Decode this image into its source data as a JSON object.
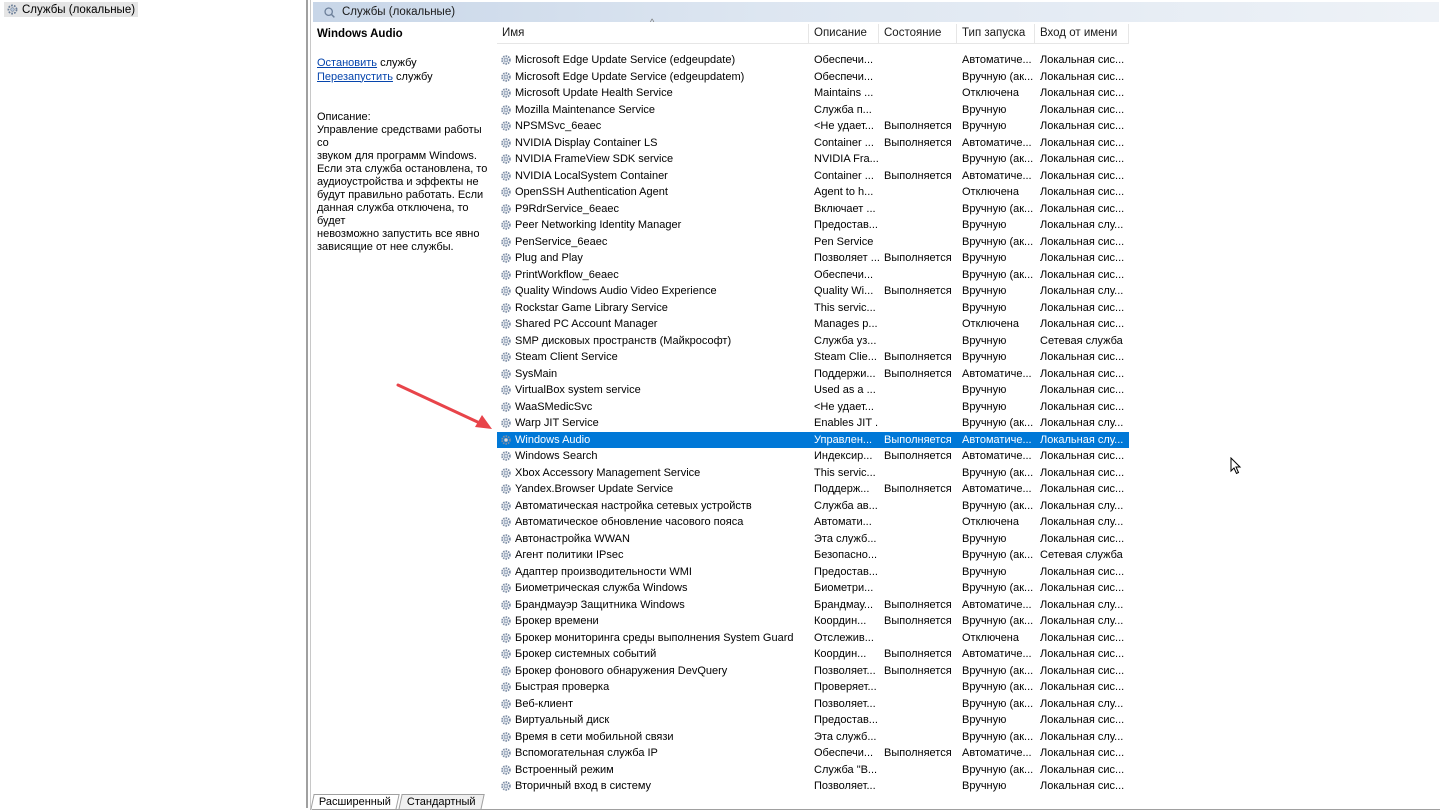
{
  "tree": {
    "root_label": "Службы (локальные)"
  },
  "header": {
    "title": "Службы (локальные)"
  },
  "details": {
    "service_title": "Windows Audio",
    "stop_link": "Остановить",
    "stop_suffix": " службу",
    "restart_link": "Перезапустить",
    "restart_suffix": " службу",
    "description_label": "Описание:",
    "description_lines": [
      "Управление средствами работы со",
      "звуком для программ Windows.",
      "Если эта служба остановлена, то",
      "аудиоустройства и эффекты не",
      "будут правильно работать.  Если",
      "данная служба отключена, то будет",
      "невозможно запустить все явно",
      "зависящие от нее службы."
    ]
  },
  "columns": {
    "name": "Имя",
    "description": "Описание",
    "state": "Состояние",
    "startup": "Тип запуска",
    "logon": "Вход от имени"
  },
  "selected_index": 23,
  "services": [
    [
      "Microsoft Edge Update Service (edgeupdate)",
      "Обеспечи...",
      "",
      "Автоматиче...",
      "Локальная сис..."
    ],
    [
      "Microsoft Edge Update Service (edgeupdatem)",
      "Обеспечи...",
      "",
      "Вручную (ак...",
      "Локальная сис..."
    ],
    [
      "Microsoft Update Health Service",
      "Maintains ...",
      "",
      "Отключена",
      "Локальная сис..."
    ],
    [
      "Mozilla Maintenance Service",
      "Служба п...",
      "",
      "Вручную",
      "Локальная сис..."
    ],
    [
      "NPSMSvc_6eaec",
      "<Не удает...",
      "Выполняется",
      "Вручную",
      "Локальная сис..."
    ],
    [
      "NVIDIA Display Container LS",
      "Container ...",
      "Выполняется",
      "Автоматиче...",
      "Локальная сис..."
    ],
    [
      "NVIDIA FrameView SDK service",
      "NVIDIA Fra...",
      "",
      "Вручную (ак...",
      "Локальная сис..."
    ],
    [
      "NVIDIA LocalSystem Container",
      "Container ...",
      "Выполняется",
      "Автоматиче...",
      "Локальная сис..."
    ],
    [
      "OpenSSH Authentication Agent",
      "Agent to h...",
      "",
      "Отключена",
      "Локальная сис..."
    ],
    [
      "P9RdrService_6eaec",
      "Включает ...",
      "",
      "Вручную (ак...",
      "Локальная сис..."
    ],
    [
      "Peer Networking Identity Manager",
      "Предостав...",
      "",
      "Вручную",
      "Локальная слу..."
    ],
    [
      "PenService_6eaec",
      "Pen Service",
      "",
      "Вручную (ак...",
      "Локальная сис..."
    ],
    [
      "Plug and Play",
      "Позволяет ...",
      "Выполняется",
      "Вручную",
      "Локальная сис..."
    ],
    [
      "PrintWorkflow_6eaec",
      "Обеспечи...",
      "",
      "Вручную (ак...",
      "Локальная сис..."
    ],
    [
      "Quality Windows Audio Video Experience",
      "Quality Wi...",
      "Выполняется",
      "Вручную",
      "Локальная слу..."
    ],
    [
      "Rockstar Game Library Service",
      "This servic...",
      "",
      "Вручную",
      "Локальная сис..."
    ],
    [
      "Shared PC Account Manager",
      "Manages p...",
      "",
      "Отключена",
      "Локальная сис..."
    ],
    [
      "SMP дисковых пространств (Майкрософт)",
      "Служба уз...",
      "",
      "Вручную",
      "Сетевая служба"
    ],
    [
      "Steam Client Service",
      "Steam Clie...",
      "Выполняется",
      "Вручную",
      "Локальная сис..."
    ],
    [
      "SysMain",
      "Поддержи...",
      "Выполняется",
      "Автоматиче...",
      "Локальная сис..."
    ],
    [
      "VirtualBox system service",
      "Used as a ...",
      "",
      "Вручную",
      "Локальная сис..."
    ],
    [
      "WaaSMedicSvc",
      "<Не удает...",
      "",
      "Вручную",
      "Локальная сис..."
    ],
    [
      "Warp JIT Service",
      "Enables JIT ...",
      "",
      "Вручную (ак...",
      "Локальная слу..."
    ],
    [
      "Windows Audio",
      "Управлен...",
      "Выполняется",
      "Автоматиче...",
      "Локальная слу..."
    ],
    [
      "Windows Search",
      "Индексир...",
      "Выполняется",
      "Автоматиче...",
      "Локальная сис..."
    ],
    [
      "Xbox Accessory Management Service",
      "This servic...",
      "",
      "Вручную (ак...",
      "Локальная сис..."
    ],
    [
      "Yandex.Browser Update Service",
      "Поддерж...",
      "Выполняется",
      "Автоматиче...",
      "Локальная сис..."
    ],
    [
      "Автоматическая настройка сетевых устройств",
      "Служба ав...",
      "",
      "Вручную (ак...",
      "Локальная слу..."
    ],
    [
      "Автоматическое обновление часового пояса",
      "Автомати...",
      "",
      "Отключена",
      "Локальная слу..."
    ],
    [
      "Автонастройка WWAN",
      "Эта служб...",
      "",
      "Вручную",
      "Локальная сис..."
    ],
    [
      "Агент политики IPsec",
      "Безопасно...",
      "",
      "Вручную (ак...",
      "Сетевая служба"
    ],
    [
      "Адаптер производительности WMI",
      "Предостав...",
      "",
      "Вручную",
      "Локальная сис..."
    ],
    [
      "Биометрическая служба Windows",
      "Биометри...",
      "",
      "Вручную (ак...",
      "Локальная сис..."
    ],
    [
      "Брандмауэр Защитника Windows",
      "Брандмау...",
      "Выполняется",
      "Автоматиче...",
      "Локальная слу..."
    ],
    [
      "Брокер времени",
      "Координ...",
      "Выполняется",
      "Вручную (ак...",
      "Локальная слу..."
    ],
    [
      "Брокер мониторинга среды выполнения System Guard",
      "Отслежив...",
      "",
      "Отключена",
      "Локальная сис..."
    ],
    [
      "Брокер системных событий",
      "Координ...",
      "Выполняется",
      "Автоматиче...",
      "Локальная сис..."
    ],
    [
      "Брокер фонового обнаружения DevQuery",
      "Позволяет...",
      "Выполняется",
      "Вручную (ак...",
      "Локальная сис..."
    ],
    [
      "Быстрая проверка",
      "Проверяет...",
      "",
      "Вручную (ак...",
      "Локальная сис..."
    ],
    [
      "Веб-клиент",
      "Позволяет...",
      "",
      "Вручную (ак...",
      "Локальная слу..."
    ],
    [
      "Виртуальный диск",
      "Предостав...",
      "",
      "Вручную",
      "Локальная сис..."
    ],
    [
      "Время в сети мобильной связи",
      "Эта служб...",
      "",
      "Вручную (ак...",
      "Локальная слу..."
    ],
    [
      "Вспомогательная служба IP",
      "Обеспечи...",
      "Выполняется",
      "Автоматиче...",
      "Локальная сис..."
    ],
    [
      "Встроенный режим",
      "Служба \"В...",
      "",
      "Вручную (ак...",
      "Локальная сис..."
    ],
    [
      "Вторичный вход в систему",
      "Позволяет...",
      "",
      "Вручную",
      "Локальная сис..."
    ]
  ],
  "tabs": [
    "Расширенный",
    "Стандартный"
  ],
  "colors": {
    "selection": "#0078d7",
    "link": "#0645ad",
    "arrow": "#e8444a"
  }
}
